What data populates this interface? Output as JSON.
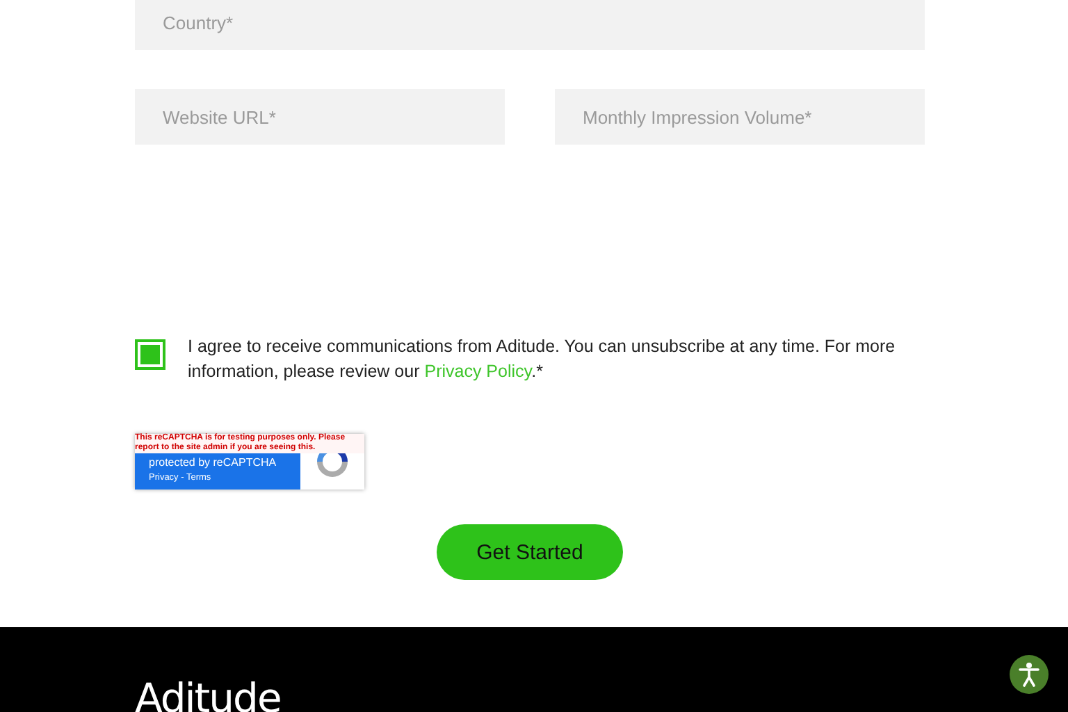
{
  "form": {
    "fields": [
      {
        "placeholder": "Country*",
        "half": false
      },
      {
        "placeholder": "Website URL*",
        "half": true
      },
      {
        "placeholder": "Monthly Impression Volume*",
        "half": true
      }
    ],
    "consent": {
      "checked": true,
      "text": "I agree to receive communications from Aditude. You can unsubscribe at any time. For more information, please review our ",
      "link": "Privacy Policy",
      "suffix": ".*"
    },
    "recaptcha": {
      "warning": "This reCAPTCHA is for testing purposes only. Please report to the site admin if you are seeing this.",
      "label": "protected by reCAPTCHA",
      "links": "Privacy - Terms"
    },
    "submit": "Get Started"
  },
  "footer": {
    "logo": "Aditude"
  }
}
